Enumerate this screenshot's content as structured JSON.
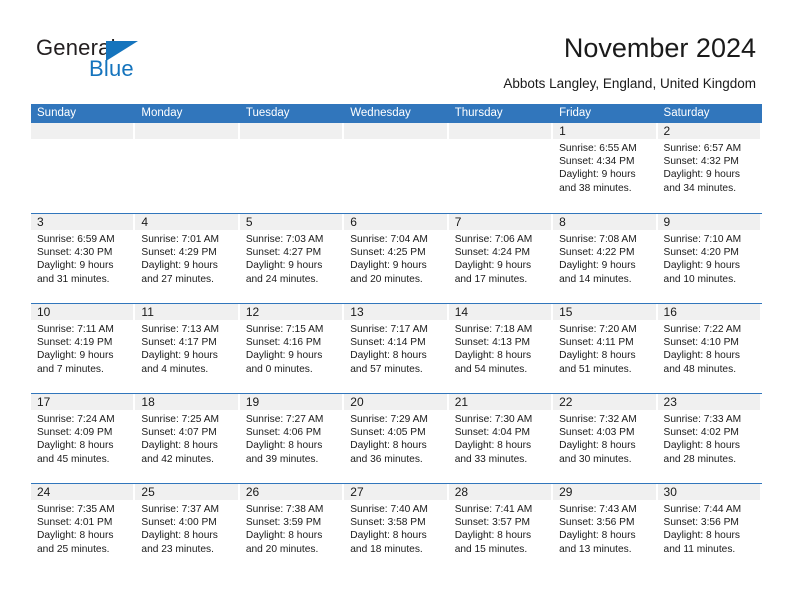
{
  "brand": {
    "name_part1": "General",
    "name_part2": "Blue",
    "triangle_color": "#1574bd"
  },
  "header": {
    "title": "November 2024",
    "subtitle": "Abbots Langley, England, United Kingdom"
  },
  "theme": {
    "header_blue": "#3176bc",
    "day_band_gray": "#f0f0f0",
    "text": "#1a1a1a",
    "brand_blue": "#1574bd"
  },
  "weekdays": [
    "Sunday",
    "Monday",
    "Tuesday",
    "Wednesday",
    "Thursday",
    "Friday",
    "Saturday"
  ],
  "labels": {
    "sunrise_prefix": "Sunrise:",
    "sunset_prefix": "Sunset:",
    "daylight_prefix": "Daylight:"
  },
  "weeks": [
    [
      {
        "empty": true
      },
      {
        "empty": true
      },
      {
        "empty": true
      },
      {
        "empty": true
      },
      {
        "empty": true
      },
      {
        "empty": false,
        "day": "1",
        "sunrise": "Sunrise: 6:55 AM",
        "sunset": "Sunset: 4:34 PM",
        "daylight_line1": "Daylight: 9 hours",
        "daylight_line2": "and 38 minutes."
      },
      {
        "empty": false,
        "day": "2",
        "sunrise": "Sunrise: 6:57 AM",
        "sunset": "Sunset: 4:32 PM",
        "daylight_line1": "Daylight: 9 hours",
        "daylight_line2": "and 34 minutes."
      }
    ],
    [
      {
        "empty": false,
        "day": "3",
        "sunrise": "Sunrise: 6:59 AM",
        "sunset": "Sunset: 4:30 PM",
        "daylight_line1": "Daylight: 9 hours",
        "daylight_line2": "and 31 minutes."
      },
      {
        "empty": false,
        "day": "4",
        "sunrise": "Sunrise: 7:01 AM",
        "sunset": "Sunset: 4:29 PM",
        "daylight_line1": "Daylight: 9 hours",
        "daylight_line2": "and 27 minutes."
      },
      {
        "empty": false,
        "day": "5",
        "sunrise": "Sunrise: 7:03 AM",
        "sunset": "Sunset: 4:27 PM",
        "daylight_line1": "Daylight: 9 hours",
        "daylight_line2": "and 24 minutes."
      },
      {
        "empty": false,
        "day": "6",
        "sunrise": "Sunrise: 7:04 AM",
        "sunset": "Sunset: 4:25 PM",
        "daylight_line1": "Daylight: 9 hours",
        "daylight_line2": "and 20 minutes."
      },
      {
        "empty": false,
        "day": "7",
        "sunrise": "Sunrise: 7:06 AM",
        "sunset": "Sunset: 4:24 PM",
        "daylight_line1": "Daylight: 9 hours",
        "daylight_line2": "and 17 minutes."
      },
      {
        "empty": false,
        "day": "8",
        "sunrise": "Sunrise: 7:08 AM",
        "sunset": "Sunset: 4:22 PM",
        "daylight_line1": "Daylight: 9 hours",
        "daylight_line2": "and 14 minutes."
      },
      {
        "empty": false,
        "day": "9",
        "sunrise": "Sunrise: 7:10 AM",
        "sunset": "Sunset: 4:20 PM",
        "daylight_line1": "Daylight: 9 hours",
        "daylight_line2": "and 10 minutes."
      }
    ],
    [
      {
        "empty": false,
        "day": "10",
        "sunrise": "Sunrise: 7:11 AM",
        "sunset": "Sunset: 4:19 PM",
        "daylight_line1": "Daylight: 9 hours",
        "daylight_line2": "and 7 minutes."
      },
      {
        "empty": false,
        "day": "11",
        "sunrise": "Sunrise: 7:13 AM",
        "sunset": "Sunset: 4:17 PM",
        "daylight_line1": "Daylight: 9 hours",
        "daylight_line2": "and 4 minutes."
      },
      {
        "empty": false,
        "day": "12",
        "sunrise": "Sunrise: 7:15 AM",
        "sunset": "Sunset: 4:16 PM",
        "daylight_line1": "Daylight: 9 hours",
        "daylight_line2": "and 0 minutes."
      },
      {
        "empty": false,
        "day": "13",
        "sunrise": "Sunrise: 7:17 AM",
        "sunset": "Sunset: 4:14 PM",
        "daylight_line1": "Daylight: 8 hours",
        "daylight_line2": "and 57 minutes."
      },
      {
        "empty": false,
        "day": "14",
        "sunrise": "Sunrise: 7:18 AM",
        "sunset": "Sunset: 4:13 PM",
        "daylight_line1": "Daylight: 8 hours",
        "daylight_line2": "and 54 minutes."
      },
      {
        "empty": false,
        "day": "15",
        "sunrise": "Sunrise: 7:20 AM",
        "sunset": "Sunset: 4:11 PM",
        "daylight_line1": "Daylight: 8 hours",
        "daylight_line2": "and 51 minutes."
      },
      {
        "empty": false,
        "day": "16",
        "sunrise": "Sunrise: 7:22 AM",
        "sunset": "Sunset: 4:10 PM",
        "daylight_line1": "Daylight: 8 hours",
        "daylight_line2": "and 48 minutes."
      }
    ],
    [
      {
        "empty": false,
        "day": "17",
        "sunrise": "Sunrise: 7:24 AM",
        "sunset": "Sunset: 4:09 PM",
        "daylight_line1": "Daylight: 8 hours",
        "daylight_line2": "and 45 minutes."
      },
      {
        "empty": false,
        "day": "18",
        "sunrise": "Sunrise: 7:25 AM",
        "sunset": "Sunset: 4:07 PM",
        "daylight_line1": "Daylight: 8 hours",
        "daylight_line2": "and 42 minutes."
      },
      {
        "empty": false,
        "day": "19",
        "sunrise": "Sunrise: 7:27 AM",
        "sunset": "Sunset: 4:06 PM",
        "daylight_line1": "Daylight: 8 hours",
        "daylight_line2": "and 39 minutes."
      },
      {
        "empty": false,
        "day": "20",
        "sunrise": "Sunrise: 7:29 AM",
        "sunset": "Sunset: 4:05 PM",
        "daylight_line1": "Daylight: 8 hours",
        "daylight_line2": "and 36 minutes."
      },
      {
        "empty": false,
        "day": "21",
        "sunrise": "Sunrise: 7:30 AM",
        "sunset": "Sunset: 4:04 PM",
        "daylight_line1": "Daylight: 8 hours",
        "daylight_line2": "and 33 minutes."
      },
      {
        "empty": false,
        "day": "22",
        "sunrise": "Sunrise: 7:32 AM",
        "sunset": "Sunset: 4:03 PM",
        "daylight_line1": "Daylight: 8 hours",
        "daylight_line2": "and 30 minutes."
      },
      {
        "empty": false,
        "day": "23",
        "sunrise": "Sunrise: 7:33 AM",
        "sunset": "Sunset: 4:02 PM",
        "daylight_line1": "Daylight: 8 hours",
        "daylight_line2": "and 28 minutes."
      }
    ],
    [
      {
        "empty": false,
        "day": "24",
        "sunrise": "Sunrise: 7:35 AM",
        "sunset": "Sunset: 4:01 PM",
        "daylight_line1": "Daylight: 8 hours",
        "daylight_line2": "and 25 minutes."
      },
      {
        "empty": false,
        "day": "25",
        "sunrise": "Sunrise: 7:37 AM",
        "sunset": "Sunset: 4:00 PM",
        "daylight_line1": "Daylight: 8 hours",
        "daylight_line2": "and 23 minutes."
      },
      {
        "empty": false,
        "day": "26",
        "sunrise": "Sunrise: 7:38 AM",
        "sunset": "Sunset: 3:59 PM",
        "daylight_line1": "Daylight: 8 hours",
        "daylight_line2": "and 20 minutes."
      },
      {
        "empty": false,
        "day": "27",
        "sunrise": "Sunrise: 7:40 AM",
        "sunset": "Sunset: 3:58 PM",
        "daylight_line1": "Daylight: 8 hours",
        "daylight_line2": "and 18 minutes."
      },
      {
        "empty": false,
        "day": "28",
        "sunrise": "Sunrise: 7:41 AM",
        "sunset": "Sunset: 3:57 PM",
        "daylight_line1": "Daylight: 8 hours",
        "daylight_line2": "and 15 minutes."
      },
      {
        "empty": false,
        "day": "29",
        "sunrise": "Sunrise: 7:43 AM",
        "sunset": "Sunset: 3:56 PM",
        "daylight_line1": "Daylight: 8 hours",
        "daylight_line2": "and 13 minutes."
      },
      {
        "empty": false,
        "day": "30",
        "sunrise": "Sunrise: 7:44 AM",
        "sunset": "Sunset: 3:56 PM",
        "daylight_line1": "Daylight: 8 hours",
        "daylight_line2": "and 11 minutes."
      }
    ]
  ]
}
